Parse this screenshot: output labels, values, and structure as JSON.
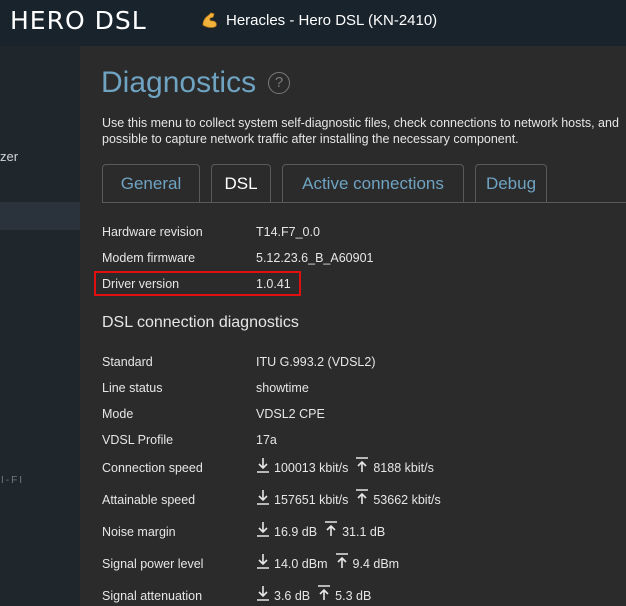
{
  "header": {
    "brand": "HERO DSL",
    "device_title": "Heracles - Hero DSL (KN-2410)"
  },
  "sidebar": {
    "partial_label": "zer",
    "section_label": "I-FI"
  },
  "page": {
    "title": "Diagnostics",
    "help_glyph": "?",
    "description_line1": "Use this menu to collect system self-diagnostic files, check connections to network hosts, and",
    "description_line2": "possible to capture network traffic after installing the necessary component."
  },
  "tabs": [
    {
      "label": "General"
    },
    {
      "label": "DSL"
    },
    {
      "label": "Active connections"
    },
    {
      "label": "Debug"
    }
  ],
  "info": [
    {
      "key": "Hardware revision",
      "value": "T14.F7_0.0"
    },
    {
      "key": "Modem firmware",
      "value": "5.12.23.6_B_A60901"
    },
    {
      "key": "Driver version",
      "value": "1.0.41"
    }
  ],
  "dsl_section_title": "DSL connection diagnostics",
  "dsl": [
    {
      "key": "Standard",
      "value": "ITU G.993.2 (VDSL2)"
    },
    {
      "key": "Line status",
      "value": "showtime"
    },
    {
      "key": "Mode",
      "value": "VDSL2 CPE"
    },
    {
      "key": "VDSL Profile",
      "value": "17a"
    }
  ],
  "dsl_rates": [
    {
      "key": "Connection speed",
      "down": "100013 kbit/s",
      "up": "8188 kbit/s"
    },
    {
      "key": "Attainable speed",
      "down": "157651 kbit/s",
      "up": "53662 kbit/s"
    },
    {
      "key": "Noise margin",
      "down": "16.9 dB",
      "up": "31.1 dB"
    },
    {
      "key": "Signal power level",
      "down": "14.0 dBm",
      "up": "9.4 dBm"
    },
    {
      "key": "Signal attenuation",
      "down": "3.6 dB",
      "up": "5.3 dB"
    }
  ],
  "colors": {
    "accent": "#6fa3c2",
    "highlight": "#e01010",
    "topbar": "#18232c"
  }
}
